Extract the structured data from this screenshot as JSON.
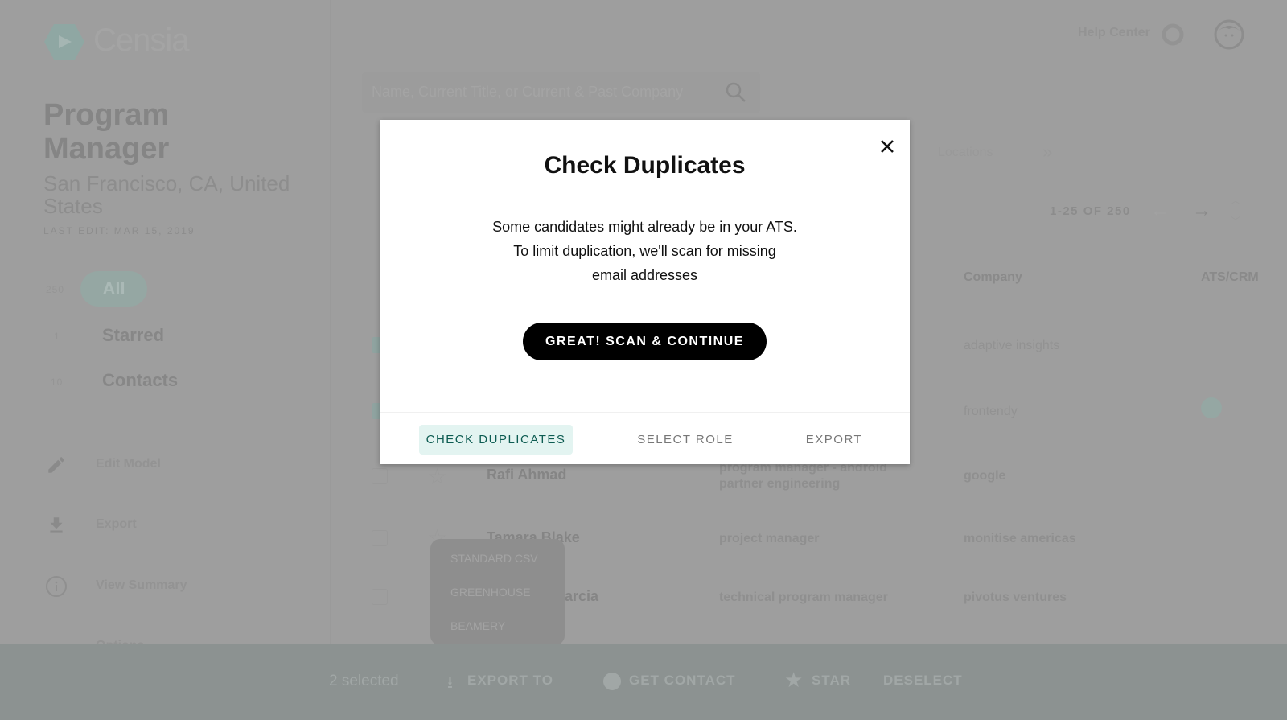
{
  "app": {
    "logo_text": "Censia",
    "brand_color": "#8fa7a3"
  },
  "header": {
    "help_center": "Help Center",
    "help_icon": "lifebuoy-icon",
    "avatar_icon": "user-face-icon"
  },
  "sidebar": {
    "title": "Program Manager",
    "location": "San Francisco, CA, United States",
    "last_edit": "LAST EDIT: MAR 15, 2019",
    "filters": [
      {
        "count": "250",
        "label": "All",
        "active": true
      },
      {
        "count": "1",
        "label": "Starred"
      },
      {
        "count": "10",
        "label": "Contacts"
      }
    ],
    "actions": [
      {
        "icon": "pencil-icon",
        "label": "Edit Model"
      },
      {
        "icon": "download-icon",
        "label": "Export"
      },
      {
        "icon": "info-icon",
        "label": "View Summary"
      },
      {
        "icon": "",
        "label": "Options"
      }
    ]
  },
  "search": {
    "placeholder": "Name, Current Title, or Current & Past Company"
  },
  "filters_bar": {
    "locations": "Locations"
  },
  "pagination": {
    "range": "1-25 OF 250"
  },
  "table": {
    "headers": {
      "company": "Company",
      "ats": "ATS/CRM"
    },
    "rows": [
      {
        "name": "",
        "title": "",
        "company": "adaptive insights",
        "checked": true
      },
      {
        "name": "",
        "title": "",
        "company": "frontendy",
        "checked": true,
        "ats_badge": true
      },
      {
        "name": "Rafi Ahmad",
        "title": "program manager - android partner engineering",
        "company": "google",
        "checked": false
      },
      {
        "name": "Tamara Blake",
        "title": "project manager",
        "company": "monitise americas",
        "checked": false
      },
      {
        "name": "arcia",
        "title": "technical program manager",
        "company": "pivotus ventures",
        "checked": false
      }
    ]
  },
  "export_dropdown": {
    "options": [
      "STANDARD CSV",
      "GREENHOUSE",
      "BEAMERY"
    ]
  },
  "bottom_bar": {
    "selected": "2 selected",
    "export_to": "EXPORT TO",
    "get_contact": "GET CONTACT",
    "star": "STAR",
    "deselect": "DESELECT"
  },
  "modal": {
    "title": "Check Duplicates",
    "body_lines": [
      "Some candidates might already be in your ATS.",
      "To limit duplication, we'll scan for missing",
      "email addresses"
    ],
    "primary_button": "GREAT! SCAN & CONTINUE",
    "steps": [
      {
        "label": "CHECK DUPLICATES",
        "active": true
      },
      {
        "label": "SELECT ROLE",
        "active": false
      },
      {
        "label": "EXPORT",
        "active": false
      }
    ]
  }
}
